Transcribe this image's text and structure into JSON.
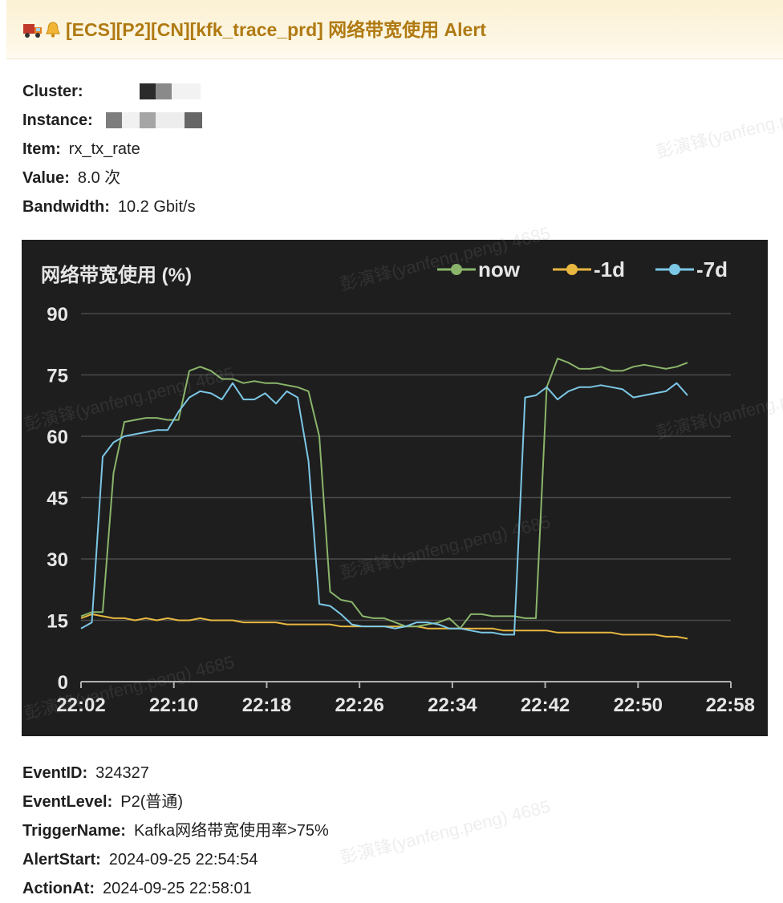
{
  "header": {
    "icons": [
      "truck-icon",
      "bell-icon"
    ],
    "title": "[ECS][P2][CN][kfk_trace_prd] 网络带宽使用 Alert"
  },
  "fields_top": [
    {
      "label": "Cluster:",
      "value": ""
    },
    {
      "label": "Instance:",
      "value": ""
    },
    {
      "label": "Item:",
      "value": "rx_tx_rate"
    },
    {
      "label": "Value:",
      "value": "8.0 次"
    },
    {
      "label": "Bandwidth:",
      "value": "10.2 Gbit/s"
    }
  ],
  "chart_data": {
    "type": "line",
    "title": "网络带宽使用 (%)",
    "xlabel": "",
    "ylabel": "",
    "ylim": [
      0,
      90
    ],
    "yticks": [
      "0",
      "15",
      "30",
      "45",
      "60",
      "75",
      "90"
    ],
    "xticks": [
      "22:02",
      "22:10",
      "22:18",
      "22:26",
      "22:34",
      "22:42",
      "22:50",
      "22:58"
    ],
    "xrange_minutes": [
      0,
      60
    ],
    "grid": true,
    "legend_position": "top-right",
    "series": [
      {
        "name": "now",
        "color": "#8ab56a",
        "x": [
          0,
          1,
          2,
          3,
          4,
          5,
          6,
          7,
          8,
          9,
          10,
          11,
          12,
          13,
          14,
          15,
          16,
          17,
          18,
          19,
          20,
          21,
          22,
          23,
          24,
          25,
          26,
          27,
          28,
          29,
          30,
          31,
          32,
          33,
          34,
          35,
          36,
          37,
          38,
          39,
          40,
          41,
          42,
          43,
          44,
          45,
          46,
          47,
          48,
          49,
          50,
          51,
          52,
          53,
          54,
          55,
          56
        ],
        "values": [
          16,
          17,
          17,
          51,
          63.5,
          64,
          64.5,
          64.5,
          64,
          64,
          76,
          77,
          76,
          74,
          74,
          73,
          73.5,
          73,
          73,
          72.5,
          72,
          71,
          60,
          22,
          20,
          19.5,
          16,
          15.5,
          15.5,
          14.5,
          13.5,
          13.5,
          14,
          14.5,
          15.5,
          13,
          16.5,
          16.5,
          16,
          16,
          16,
          15.5,
          15.5,
          72,
          79,
          78,
          76.5,
          76.5,
          77,
          76,
          76,
          77,
          77.5,
          77,
          76.5,
          77,
          78
        ]
      },
      {
        "name": "-1d",
        "color": "#e7b740",
        "x": [
          0,
          1,
          2,
          3,
          4,
          5,
          6,
          7,
          8,
          9,
          10,
          11,
          12,
          13,
          14,
          15,
          16,
          17,
          18,
          19,
          20,
          21,
          22,
          23,
          24,
          25,
          26,
          27,
          28,
          29,
          30,
          31,
          32,
          33,
          34,
          35,
          36,
          37,
          38,
          39,
          40,
          41,
          42,
          43,
          44,
          45,
          46,
          47,
          48,
          49,
          50,
          51,
          52,
          53,
          54,
          55,
          56
        ],
        "values": [
          15.5,
          16.5,
          16,
          15.5,
          15.5,
          15,
          15.5,
          15,
          15.5,
          15,
          15,
          15.5,
          15,
          15,
          15,
          14.5,
          14.5,
          14.5,
          14.5,
          14,
          14,
          14,
          14,
          14,
          13.5,
          13.5,
          13.5,
          13.5,
          13.5,
          13.5,
          13.5,
          13.5,
          13,
          13,
          13,
          13,
          13,
          13,
          13,
          12.5,
          12.5,
          12.5,
          12.5,
          12.5,
          12,
          12,
          12,
          12,
          12,
          12,
          11.5,
          11.5,
          11.5,
          11.5,
          11,
          11,
          10.5
        ]
      },
      {
        "name": "-7d",
        "color": "#7cc7e6",
        "x": [
          0,
          1,
          2,
          3,
          4,
          5,
          6,
          7,
          8,
          9,
          10,
          11,
          12,
          13,
          14,
          15,
          16,
          17,
          18,
          19,
          20,
          21,
          22,
          23,
          24,
          25,
          26,
          27,
          28,
          29,
          30,
          31,
          32,
          33,
          34,
          35,
          36,
          37,
          38,
          39,
          40,
          41,
          42,
          43,
          44,
          45,
          46,
          47,
          48,
          49,
          50,
          51,
          52,
          53,
          54,
          55,
          56
        ],
        "values": [
          13,
          14.5,
          55,
          58.5,
          60,
          60.5,
          61,
          61.5,
          61.5,
          66,
          69.5,
          71,
          70.5,
          69,
          73,
          69,
          69,
          70.5,
          68,
          71,
          69.5,
          54,
          19,
          18.5,
          16.5,
          14,
          13.5,
          13.5,
          13.5,
          13,
          13.5,
          14.5,
          14.5,
          14,
          13,
          13,
          12.5,
          12,
          12,
          11.5,
          11.5,
          69.5,
          70,
          72,
          69,
          71,
          72,
          72,
          72.5,
          72,
          71.5,
          69.5,
          70,
          70.5,
          71,
          73,
          70
        ]
      }
    ]
  },
  "fields_bottom": [
    {
      "label": "EventID:",
      "value": "324327"
    },
    {
      "label": "EventLevel:",
      "value": "P2(普通)"
    },
    {
      "label": "TriggerName:",
      "value": "Kafka网络带宽使用率>75%"
    },
    {
      "label": "AlertStart:",
      "value": "2024-09-25 22:54:54"
    },
    {
      "label": "ActionAt:",
      "value": "2024-09-25 22:58:01"
    }
  ],
  "watermark": "彭演锋(yanfeng.peng) 4685"
}
